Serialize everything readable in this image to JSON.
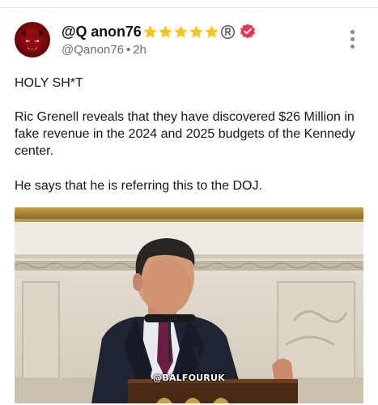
{
  "post": {
    "author": {
      "display_name": "@Q anon76",
      "badges": [
        "star-icon",
        "star-icon",
        "star-icon",
        "star-icon",
        "star-icon",
        "registered-icon",
        "verified-badge-icon"
      ],
      "handle": "@Qanon76",
      "separator": "•",
      "timestamp": "2h"
    },
    "text": {
      "line1": "HOLY SH*T",
      "paragraph2": "Ric Grenell reveals that they have discovered $26 Million in fake revenue in the 2024 and 2025 budgets of the Kennedy center.",
      "paragraph3": "He says that he is referring this to the DOJ."
    },
    "media": {
      "watermark": "@BALFOURUK"
    }
  },
  "colors": {
    "star": "#f5c518",
    "verified": "#f0344c",
    "muted_text": "#6e6e6e"
  }
}
